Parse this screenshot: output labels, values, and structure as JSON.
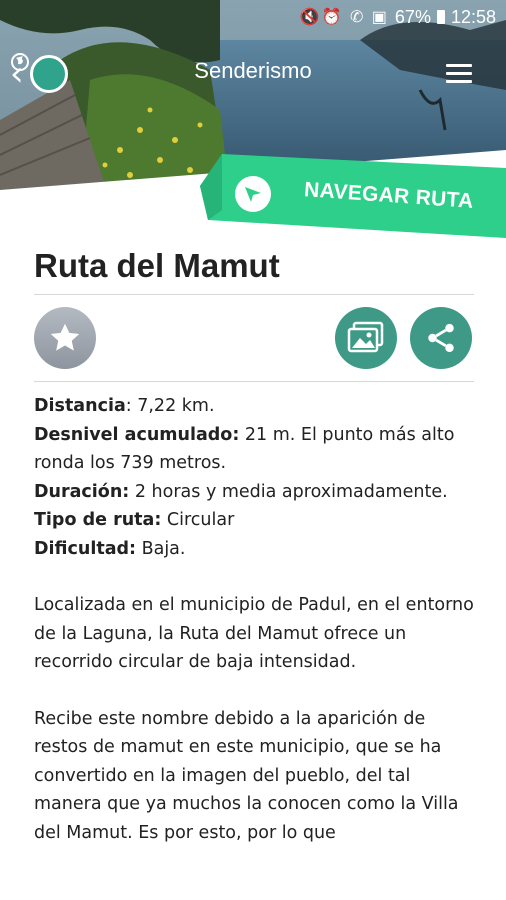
{
  "status_bar": {
    "icons": "🔇⏰ ✆ ▣",
    "battery": "67%",
    "time": "12:58"
  },
  "app_bar": {
    "title": "Senderismo"
  },
  "navigate_button": {
    "label": "NAVEGAR RUTA"
  },
  "route": {
    "title": "Ruta del Mamut",
    "details": [
      {
        "label": "Distancia",
        "sep": ":",
        "value": " 7,22 km."
      },
      {
        "label": "Desnivel acumulado:",
        "sep": "",
        "value": " 21 m. El punto más alto ronda los 739 metros."
      },
      {
        "label": "Duración:",
        "sep": "",
        "value": " 2 horas y media aproximadamente."
      },
      {
        "label": "Tipo de ruta:",
        "sep": "",
        "value": " Circular"
      },
      {
        "label": "Dificultad:",
        "sep": "",
        "value": " Baja."
      }
    ],
    "paragraph_1": "Localizada en el municipio de Padul, en el entorno de la Laguna, la Ruta del Mamut ofrece un recorrido circular de baja intensidad.",
    "paragraph_2": "Recibe este nombre debido a la aparición de restos de mamut en este municipio, que se ha convertido en la imagen del pueblo, del tal manera que ya muchos la conocen como la Villa del Mamut. Es por esto, por lo que"
  },
  "colors": {
    "accent_green": "#2ecf8a",
    "action_teal": "#3e9a86",
    "favorite_grey": "#9aa1aa"
  }
}
